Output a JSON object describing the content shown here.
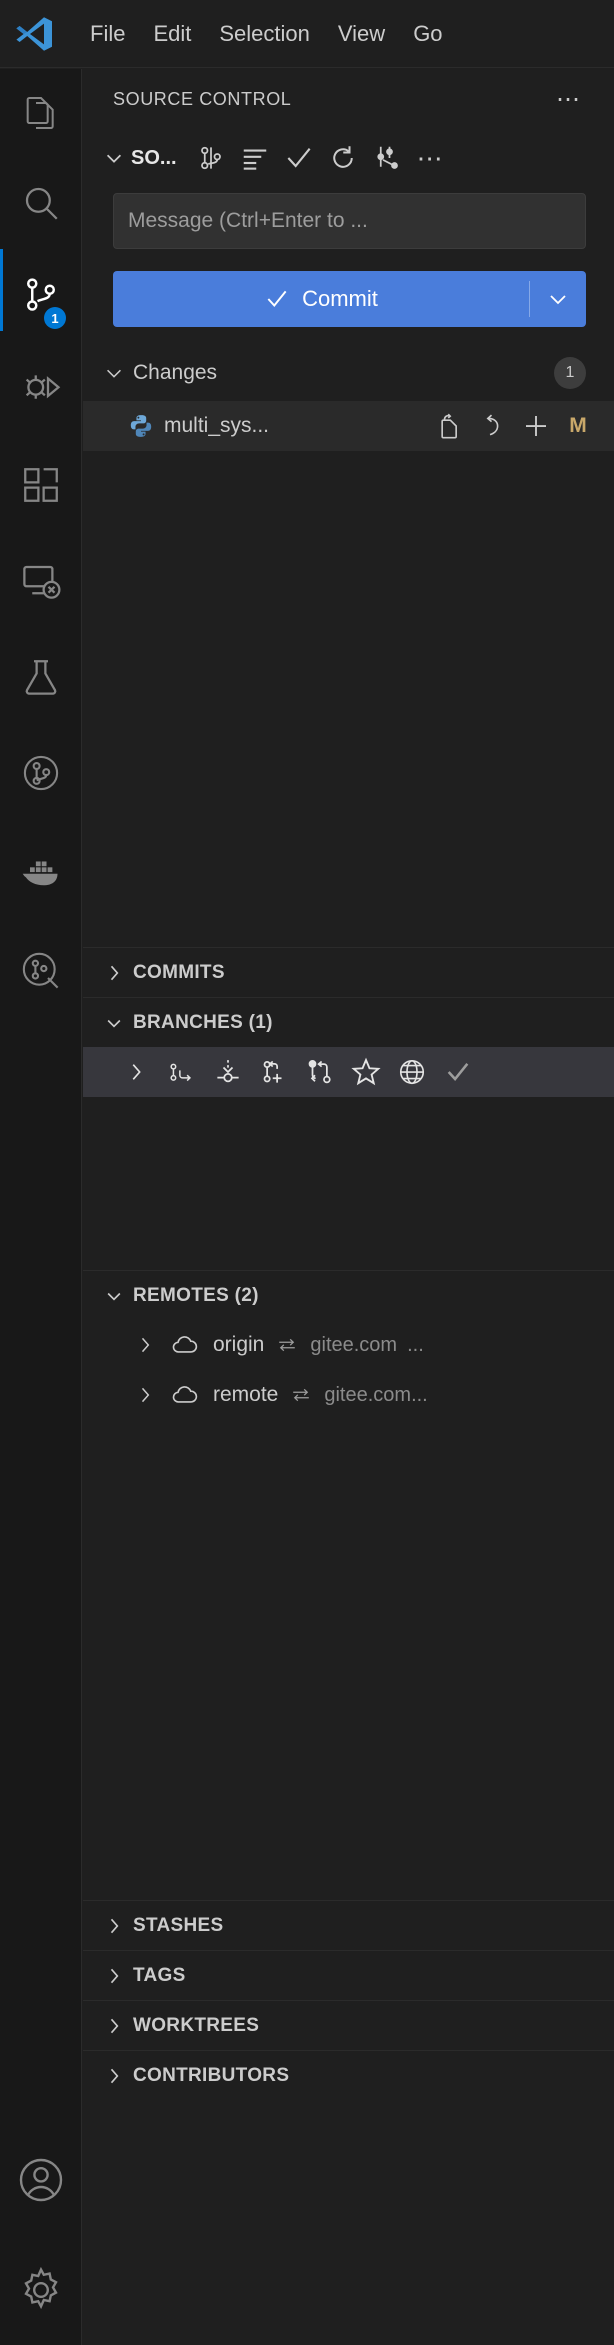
{
  "window": {
    "app": "Visual Studio Code",
    "logo_icon": "vscode-logo"
  },
  "menubar": {
    "items": [
      {
        "label": "File",
        "name": "menu-file"
      },
      {
        "label": "Edit",
        "name": "menu-edit"
      },
      {
        "label": "Selection",
        "name": "menu-selection"
      },
      {
        "label": "View",
        "name": "menu-view"
      },
      {
        "label": "Go",
        "name": "menu-go"
      }
    ]
  },
  "activitybar": {
    "items": [
      {
        "icon": "files-explorer-icon",
        "name": "activity-explorer",
        "active": false,
        "badge": ""
      },
      {
        "icon": "search-icon",
        "name": "activity-search",
        "active": false,
        "badge": ""
      },
      {
        "icon": "source-control-icon",
        "name": "activity-source-control",
        "active": true,
        "badge": "1"
      },
      {
        "icon": "run-and-debug-icon",
        "name": "activity-run-debug",
        "active": false,
        "badge": ""
      },
      {
        "icon": "extensions-icon",
        "name": "activity-extensions",
        "active": false,
        "badge": ""
      },
      {
        "icon": "remote-explorer-icon",
        "name": "activity-remote-explorer",
        "active": false,
        "badge": ""
      },
      {
        "icon": "testing-beaker-icon",
        "name": "activity-testing",
        "active": false,
        "badge": ""
      },
      {
        "icon": "git-graph-icon",
        "name": "activity-git-graph",
        "active": false,
        "badge": ""
      },
      {
        "icon": "docker-whale-icon",
        "name": "activity-docker",
        "active": false,
        "badge": ""
      },
      {
        "icon": "git-inspect-icon",
        "name": "activity-git-inspect",
        "active": false,
        "badge": ""
      }
    ],
    "bottom": [
      {
        "icon": "account-icon",
        "name": "activity-accounts"
      },
      {
        "icon": "gear-icon",
        "name": "activity-manage-settings"
      }
    ]
  },
  "sidebar": {
    "title": "SOURCE CONTROL",
    "title_more_icon": "more-actions-icon",
    "scm": {
      "twisty_icon": "chevron-down-icon",
      "provider_label": "SO...",
      "toolbar": [
        {
          "icon": "source-control-icon",
          "name": "scm-view-changes-button"
        },
        {
          "icon": "view-as-list-icon",
          "name": "scm-view-as-list-button"
        },
        {
          "icon": "check-icon",
          "name": "scm-commit-button"
        },
        {
          "icon": "refresh-icon",
          "name": "scm-refresh-button"
        },
        {
          "icon": "git-graph-icon",
          "name": "scm-open-graph-button"
        },
        {
          "icon": "more-actions-icon",
          "name": "scm-more-actions-button"
        }
      ]
    },
    "commit_input": {
      "value": "",
      "placeholder": "Message (Ctrl+Enter to ..."
    },
    "commit_button": {
      "label": "Commit",
      "check_icon": "check-icon",
      "caret_icon": "chevron-down-icon",
      "accent_color": "#4a7ddb"
    },
    "changes": {
      "twisty_icon": "chevron-down-icon",
      "label": "Changes",
      "count": "1",
      "files": [
        {
          "file_icon": "python-file-icon",
          "name": "multi_sys...",
          "actions": [
            {
              "icon": "open-file-icon",
              "name": "open-file-button"
            },
            {
              "icon": "discard-changes-icon",
              "name": "discard-changes-button"
            },
            {
              "icon": "stage-changes-icon",
              "name": "stage-changes-button"
            }
          ],
          "status": "M",
          "status_color": "#c9a86a"
        }
      ]
    },
    "panes": [
      {
        "label": "COMMITS",
        "name": "pane-commits",
        "twisty_icon": "chevron-right-icon",
        "expanded": false
      },
      {
        "label": "BRANCHES (1)",
        "name": "pane-branches",
        "twisty_icon": "chevron-down-icon",
        "expanded": true
      },
      {
        "label": "REMOTES (2)",
        "name": "pane-remotes",
        "twisty_icon": "chevron-down-icon",
        "expanded": true
      }
    ],
    "branches_row": {
      "twisty_icon": "chevron-right-icon",
      "icons": [
        {
          "icon": "branch-switch-icon",
          "name": "branch-switch-button"
        },
        {
          "icon": "branch-pull-icon",
          "name": "branch-pull-button"
        },
        {
          "icon": "branch-create-icon",
          "name": "branch-create-button"
        },
        {
          "icon": "branch-merge-icon",
          "name": "branch-merge-button"
        },
        {
          "icon": "star-icon",
          "name": "branch-favorite-button"
        },
        {
          "icon": "globe-icon",
          "name": "branch-publish-button"
        },
        {
          "icon": "check-icon",
          "name": "branch-current-check"
        }
      ]
    },
    "remotes": [
      {
        "twisty_icon": "chevron-right-icon",
        "cloud_icon": "cloud-icon",
        "name": "origin",
        "swap_icon": "swap-arrows-icon",
        "host": "gitee.com",
        "ellipsis": "..."
      },
      {
        "twisty_icon": "chevron-right-icon",
        "cloud_icon": "cloud-icon",
        "name": "remote",
        "swap_icon": "swap-arrows-icon",
        "host": "gitee.com...",
        "ellipsis": ""
      }
    ],
    "bottom_panes": [
      {
        "label": "STASHES",
        "name": "pane-stashes",
        "twisty_icon": "chevron-right-icon"
      },
      {
        "label": "TAGS",
        "name": "pane-tags",
        "twisty_icon": "chevron-right-icon"
      },
      {
        "label": "WORKTREES",
        "name": "pane-worktrees",
        "twisty_icon": "chevron-right-icon"
      },
      {
        "label": "CONTRIBUTORS",
        "name": "pane-contributors",
        "twisty_icon": "chevron-right-icon"
      }
    ]
  }
}
